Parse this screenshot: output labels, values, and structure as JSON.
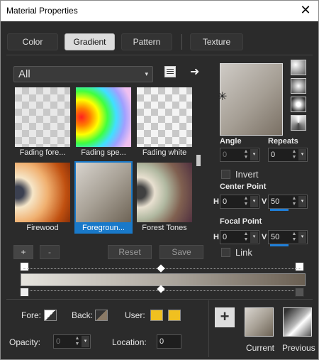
{
  "window": {
    "title": "Material Properties",
    "close": "✕"
  },
  "tabs": [
    "Color",
    "Gradient",
    "Pattern",
    "Texture"
  ],
  "dropdown": {
    "value": "All",
    "arrow": "▾"
  },
  "toolbar_icons": {
    "library": "📚",
    "arrow": "➜"
  },
  "thumbnails": [
    {
      "label": "Fading fore..."
    },
    {
      "label": "Fading spe..."
    },
    {
      "label": "Fading white"
    },
    {
      "label": "Firewood"
    },
    {
      "label": "Foregroun..."
    },
    {
      "label": "Forest Tones"
    }
  ],
  "list_buttons": {
    "add": "+",
    "remove": "-",
    "reset": "Reset",
    "save": "Save"
  },
  "angle": {
    "label": "Angle",
    "value": "0"
  },
  "repeats": {
    "label": "Repeats",
    "value": "0"
  },
  "invert": {
    "label": "Invert"
  },
  "center_point": {
    "label": "Center Point",
    "h_label": "H",
    "h_value": "0",
    "v_label": "V",
    "v_value": "50"
  },
  "focal_point": {
    "label": "Focal Point",
    "h_label": "H",
    "h_value": "0",
    "v_label": "V",
    "v_value": "50"
  },
  "link": {
    "label": "Link"
  },
  "fore": {
    "label": "Fore:"
  },
  "back": {
    "label": "Back:"
  },
  "user": {
    "label": "User:"
  },
  "opacity": {
    "label": "Opacity:",
    "value": "0"
  },
  "location": {
    "label": "Location:",
    "value": "0"
  },
  "current": {
    "label": "Current"
  },
  "previous": {
    "label": "Previous"
  },
  "add_big": "+",
  "spin_symbols": {
    "up": "▲",
    "down": "▼",
    "drop": "▾"
  },
  "colors": {
    "user_swatch": "#f0c020",
    "selection": "#1979c9",
    "accent_bar": "#1f7fd9"
  }
}
